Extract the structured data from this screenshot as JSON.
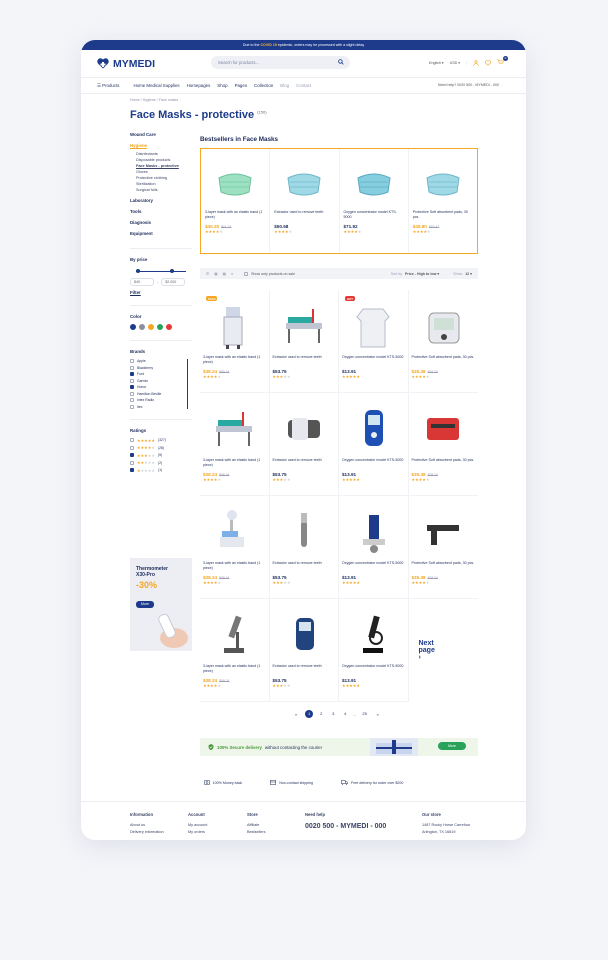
{
  "topbar": {
    "pre": "Due to the ",
    "covid": "COVID 19",
    "post": " epidemic, orders may be processed with a slight delay"
  },
  "header": {
    "logo": "MYMEDI",
    "search_placeholder": "Search for products...",
    "lang": "English",
    "currency": "USD",
    "cart_count": "0"
  },
  "nav": {
    "products": "Products",
    "items": [
      "Home Medical Supplies",
      "Homepages",
      "Shop",
      "Pages",
      "Collection"
    ],
    "muted": [
      "Blog",
      "Contact"
    ],
    "help": "Need help?  0020 500 - MYMEDI - 000"
  },
  "breadcrumb": {
    "home": "Home",
    "sep": "/",
    "l2": "Hygiene",
    "l3": "Face masks"
  },
  "page": {
    "title": "Face Masks - protective",
    "count": "(150)"
  },
  "sidebar": {
    "cats": [
      "Wound Care",
      "Hygiene"
    ],
    "subs": [
      "Disinfectants",
      "Disposable products",
      "Face Masks - protective",
      "Gloves",
      "Protective clothing",
      "Sterilization",
      "Surgical foils"
    ],
    "cats2": [
      "Laboratory",
      "Tools",
      "Diagnosis",
      "Equipment"
    ],
    "price_h": "By price",
    "price_min": "$45",
    "price_dash": "-",
    "price_max": "$2,000",
    "filter": "Filter",
    "color_h": "Color",
    "colors": [
      "#1d3b8a",
      "#8a8f9c",
      "#f5a623",
      "#29a35a",
      "#e53935"
    ],
    "brands_h": "Brands",
    "brands": [
      {
        "name": "Apple",
        "on": false
      },
      {
        "name": "Blackberry",
        "on": false
      },
      {
        "name": "Ford",
        "on": true
      },
      {
        "name": "Garmin",
        "on": false
      },
      {
        "name": "Honor",
        "on": true
      },
      {
        "name": "Hamilton Beville",
        "on": false
      },
      {
        "name": "Intex Radio",
        "on": false
      },
      {
        "name": "Itec",
        "on": false
      }
    ],
    "ratings_h": "Ratings",
    "ratings": [
      {
        "stars": 5,
        "count": "(327)",
        "on": false
      },
      {
        "stars": 4,
        "count": "(28)",
        "on": false
      },
      {
        "stars": 3,
        "count": "(5)",
        "on": true
      },
      {
        "stars": 2,
        "count": "(2)",
        "on": false
      },
      {
        "stars": 1,
        "count": "(1)",
        "on": true
      }
    ],
    "promo": {
      "title1": "Thermometer",
      "title2": "X30-Pro",
      "pct": "-30%",
      "btn": "More"
    }
  },
  "bestsellers": {
    "title": "Bestsellers in Face Masks",
    "items": [
      {
        "name": "3-layer mask with an elastic band (1 piece)",
        "price": "$40.25",
        "old": "$61.74",
        "stars": 4
      },
      {
        "name": "Extractor used to remove teeth",
        "price": "$50.58",
        "old": "",
        "stars": 4
      },
      {
        "name": "Oxygen concentrator model KTS-5000",
        "price": "$71.92",
        "old": "",
        "stars": 4
      },
      {
        "name": "Protective Soft absorbent pads, 30 pcs.",
        "price": "$49.80",
        "old": "$52.47",
        "stars": 4
      }
    ]
  },
  "toolbar": {
    "onsale": "Show only products on sale",
    "sort_l": "Sort by",
    "sort_v": "Price - High to low",
    "show_l": "Show",
    "show_v": "12"
  },
  "products": [
    {
      "name": "3-layer mask with an elastic band (1 piece)",
      "price": "$38.24",
      "old": "$59.24",
      "stars": 4,
      "badge": "SALE",
      "img": "cart"
    },
    {
      "name": "Extractor used to remove teeth",
      "price": "$53.75",
      "old": "",
      "stars": 3,
      "badge": "",
      "img": "bed"
    },
    {
      "name": "Oxygen concentrator model KTS-5000",
      "price": "$13.91",
      "old": "",
      "stars": 5,
      "badge": "HOT",
      "img": "gown"
    },
    {
      "name": "Protective Soft absorbent pads, 30 pcs.",
      "price": "$35.38",
      "old": "$38.24",
      "stars": 4,
      "badge": "",
      "img": "bp"
    },
    {
      "name": "3-layer mask with an elastic band (1 piece)",
      "price": "$38.24",
      "old": "$59.24",
      "stars": 4,
      "badge": "",
      "img": "bed"
    },
    {
      "name": "Extractor used to remove teeth",
      "price": "$53.75",
      "old": "",
      "stars": 3,
      "badge": "",
      "img": "cuff"
    },
    {
      "name": "Oxygen concentrator model KTS-5000",
      "price": "$13.91",
      "old": "",
      "stars": 5,
      "badge": "",
      "img": "meter"
    },
    {
      "name": "Protective Soft absorbent pads, 30 pcs.",
      "price": "$35.38",
      "old": "$38.24",
      "stars": 4,
      "badge": "",
      "img": "kit"
    },
    {
      "name": "3-layer mask with an elastic band (1 piece)",
      "price": "$38.24",
      "old": "$59.24",
      "stars": 4,
      "badge": "",
      "img": "dental"
    },
    {
      "name": "Extractor used to remove teeth",
      "price": "$53.75",
      "old": "",
      "stars": 3,
      "badge": "",
      "img": "drill"
    },
    {
      "name": "Oxygen concentrator model KTS-5000",
      "price": "$13.91",
      "old": "",
      "stars": 5,
      "badge": "",
      "img": "chair"
    },
    {
      "name": "Protective Soft absorbent pads, 30 pcs.",
      "price": "$35.38",
      "old": "$38.24",
      "stars": 4,
      "badge": "",
      "img": "tool"
    },
    {
      "name": "3-layer mask with an elastic band (1 piece)",
      "price": "$38.24",
      "old": "$59.24",
      "stars": 4,
      "badge": "",
      "img": "micro"
    },
    {
      "name": "Extractor used to remove teeth",
      "price": "$53.75",
      "old": "",
      "stars": 3,
      "badge": "",
      "img": "meter2"
    },
    {
      "name": "Oxygen concentrator model KTS-5000",
      "price": "$13.91",
      "old": "",
      "stars": 5,
      "badge": "",
      "img": "micro2"
    }
  ],
  "next_page": {
    "line1": "Next",
    "line2": "page",
    "arrow": "›"
  },
  "pagination": {
    "prev": "«",
    "pages": [
      "1",
      "2",
      "3",
      "4"
    ],
    "ellipsis": "...",
    "last": "25",
    "next": "»"
  },
  "banner": {
    "pct": "100% Secure delivery",
    "rest": "without contacting the courier",
    "btn": "More"
  },
  "perks": [
    "100% Money back",
    "Non-contact shipping",
    "Free delivery for order over $200"
  ],
  "footer": {
    "info_h": "Information",
    "info": [
      "About us",
      "Delivery information"
    ],
    "account_h": "Account",
    "account": [
      "My account",
      "My orders"
    ],
    "store_h": "Store",
    "store": [
      "Affiliate",
      "Bestsellers"
    ],
    "help_h": "Need help",
    "phone": "0020 500 - MYMEDI - 000",
    "our_h": "Our store",
    "addr1": "1487 Rocky Horse Carrefour",
    "addr2": "Arlington, TX 16819"
  }
}
